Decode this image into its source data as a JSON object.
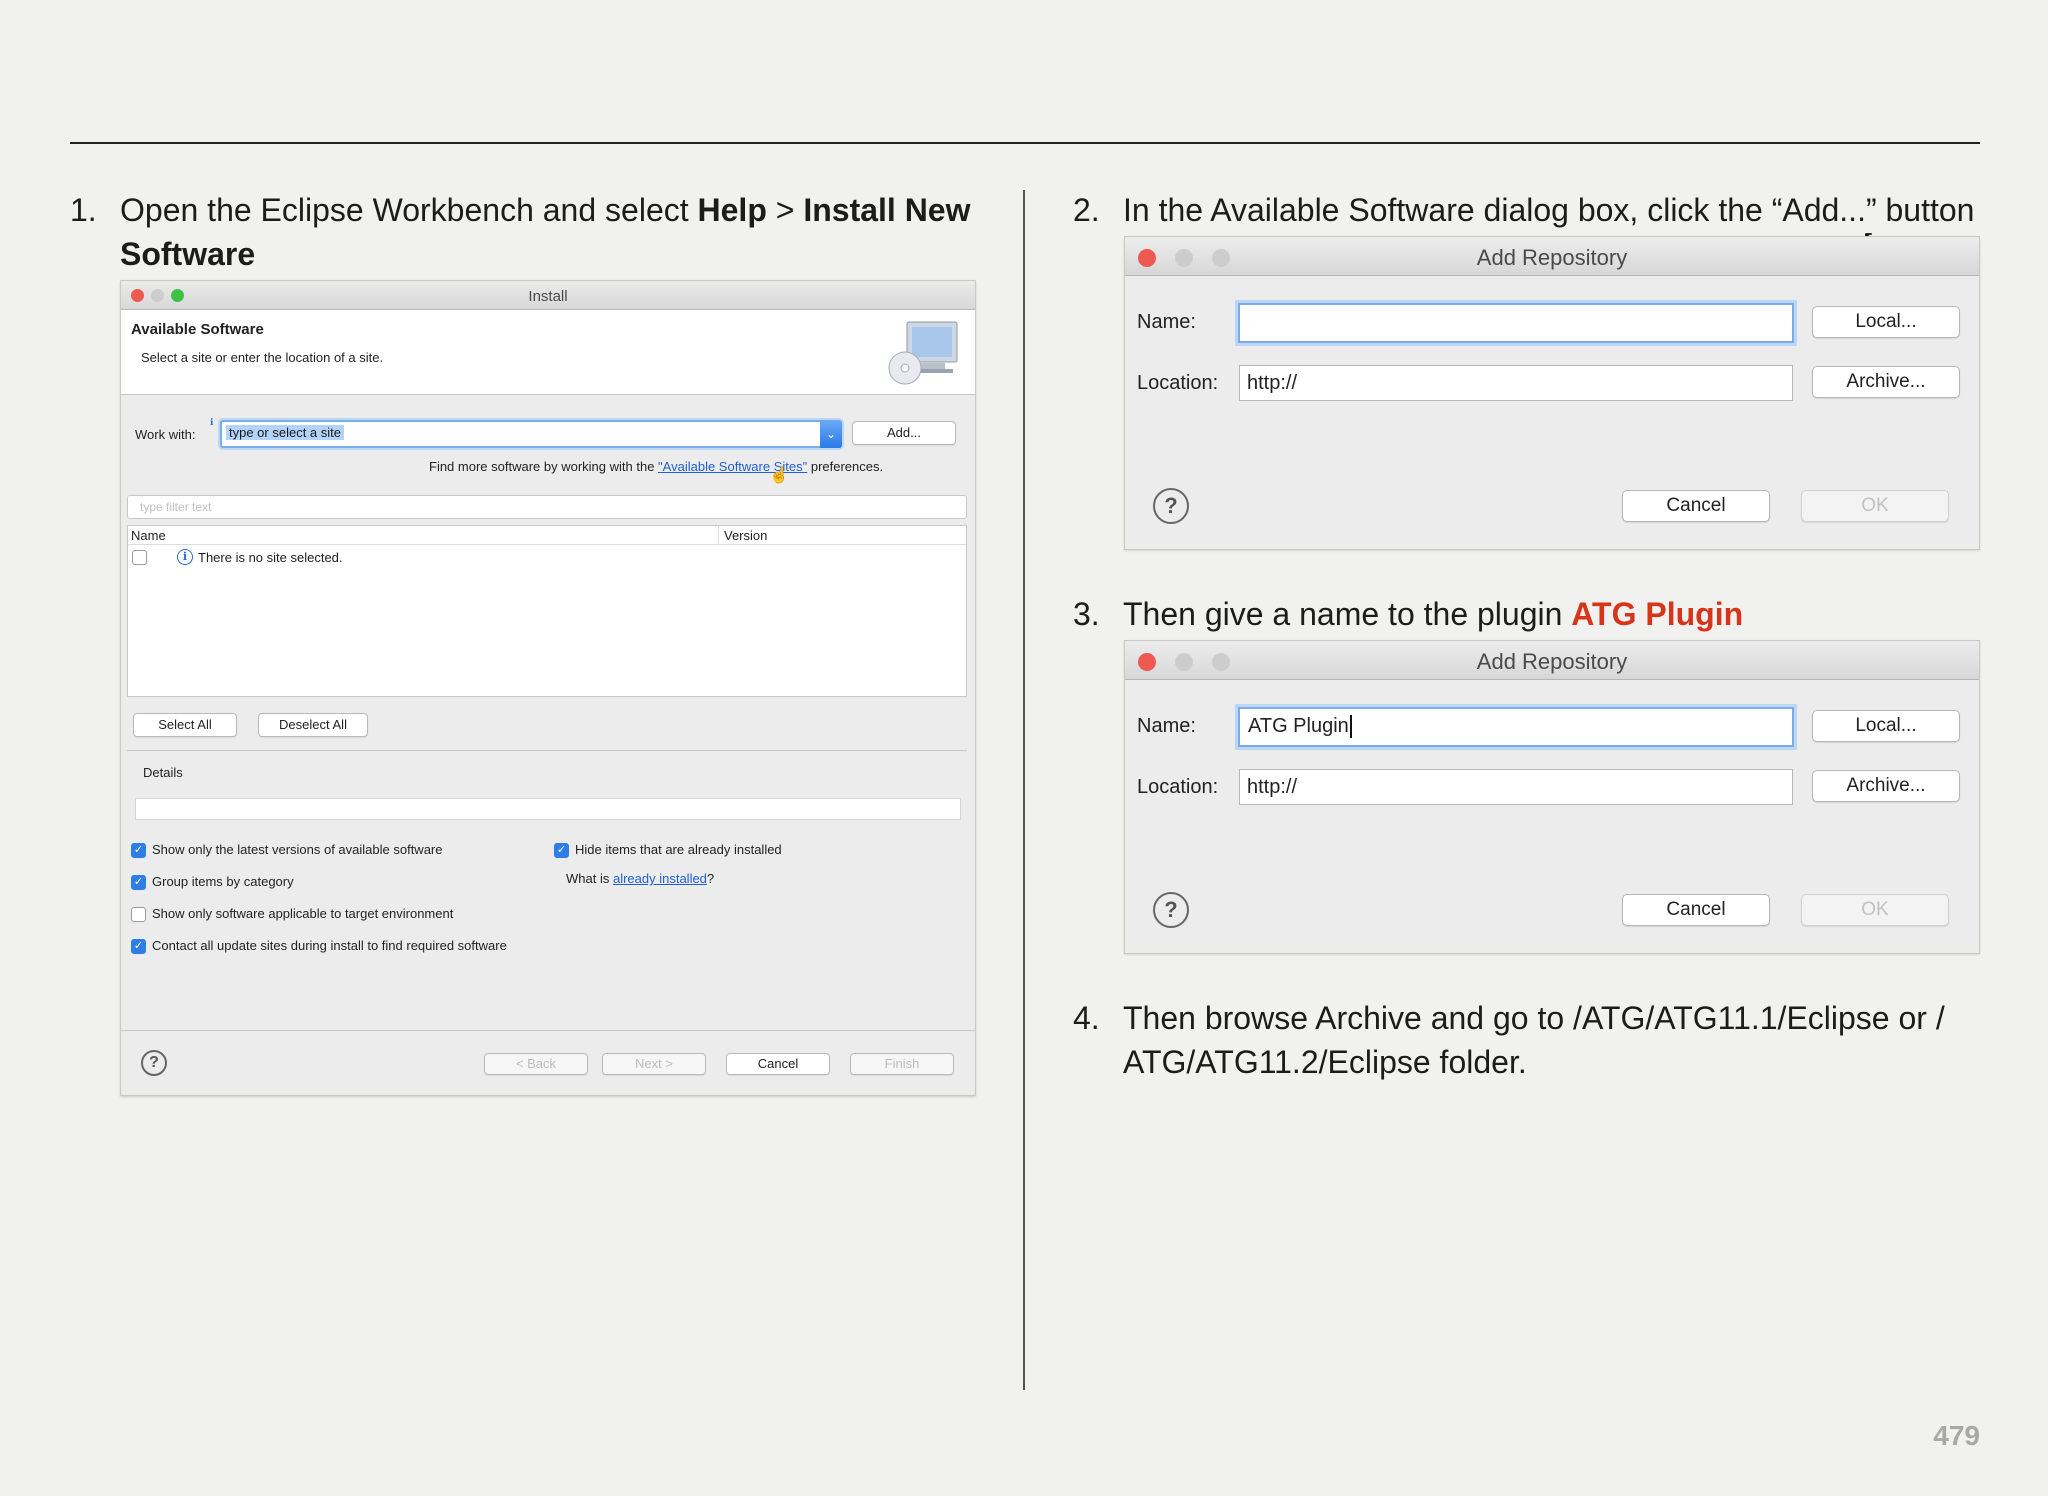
{
  "page_number": "479",
  "steps": {
    "s1": {
      "num": "1.",
      "pre": "Open the Eclipse Workbench and select ",
      "b1": "Help",
      "mid": " > ",
      "b2": "Install New",
      "b3": "Software"
    },
    "s2": {
      "num": "2.",
      "text": "In the Available Software dialog box, click the “Add...” button"
    },
    "s3": {
      "num": "3.",
      "pre": "Then give a name to the plugin ",
      "highlight": "ATG Plugin",
      "highlight_color": "#d7341a"
    },
    "s4": {
      "num": "4.",
      "line1": "Then browse Archive and go to /ATG/ATG11.1/Eclipse or /",
      "line2": "ATG/ATG11.2/Eclipse folder."
    }
  },
  "install_dialog": {
    "title": "Install",
    "heading": "Available Software",
    "subheading": "Select a site or enter the location of a site.",
    "work_with_label": "Work with:",
    "work_with_value": "type or select a site",
    "add_button": "Add...",
    "find_more_pre": "Find more software by working with the ",
    "find_more_link": "\"Available Software Sites\"",
    "find_more_post": " preferences.",
    "filter_placeholder": "type filter text",
    "col_name": "Name",
    "col_version": "Version",
    "no_site": "There is no site selected.",
    "select_all": "Select All",
    "deselect_all": "Deselect All",
    "details_label": "Details",
    "options": [
      {
        "label": "Show only the latest versions of available software",
        "checked": true
      },
      {
        "label": "Group items by category",
        "checked": true
      },
      {
        "label": "Show only software applicable to target environment",
        "checked": false
      },
      {
        "label": "Contact all update sites during install to find required software",
        "checked": true
      }
    ],
    "hide_installed": {
      "label": "Hide items that are already installed",
      "checked": true
    },
    "what_is_pre": "What is ",
    "what_is_link": "already installed",
    "what_is_post": "?",
    "back_button": "< Back",
    "next_button": "Next >",
    "cancel_button": "Cancel",
    "finish_button": "Finish"
  },
  "repo_dialog_1": {
    "title": "Add Repository",
    "name_label": "Name:",
    "name_value": "",
    "location_label": "Location:",
    "location_value": "http://",
    "local_button": "Local...",
    "archive_button": "Archive...",
    "cancel_button": "Cancel",
    "ok_button": "OK"
  },
  "repo_dialog_2": {
    "title": "Add Repository",
    "name_label": "Name:",
    "name_value": "ATG Plugin",
    "location_label": "Location:",
    "location_value": "http://",
    "local_button": "Local...",
    "archive_button": "Archive...",
    "cancel_button": "Cancel",
    "ok_button": "OK"
  },
  "colors": {
    "mac_close": "#ee5a52",
    "mac_inactive": "#cdcdcd",
    "mac_zoom": "#3cc345",
    "accent_blue": "#2f7ee8",
    "link_blue": "#1d5fd8"
  }
}
